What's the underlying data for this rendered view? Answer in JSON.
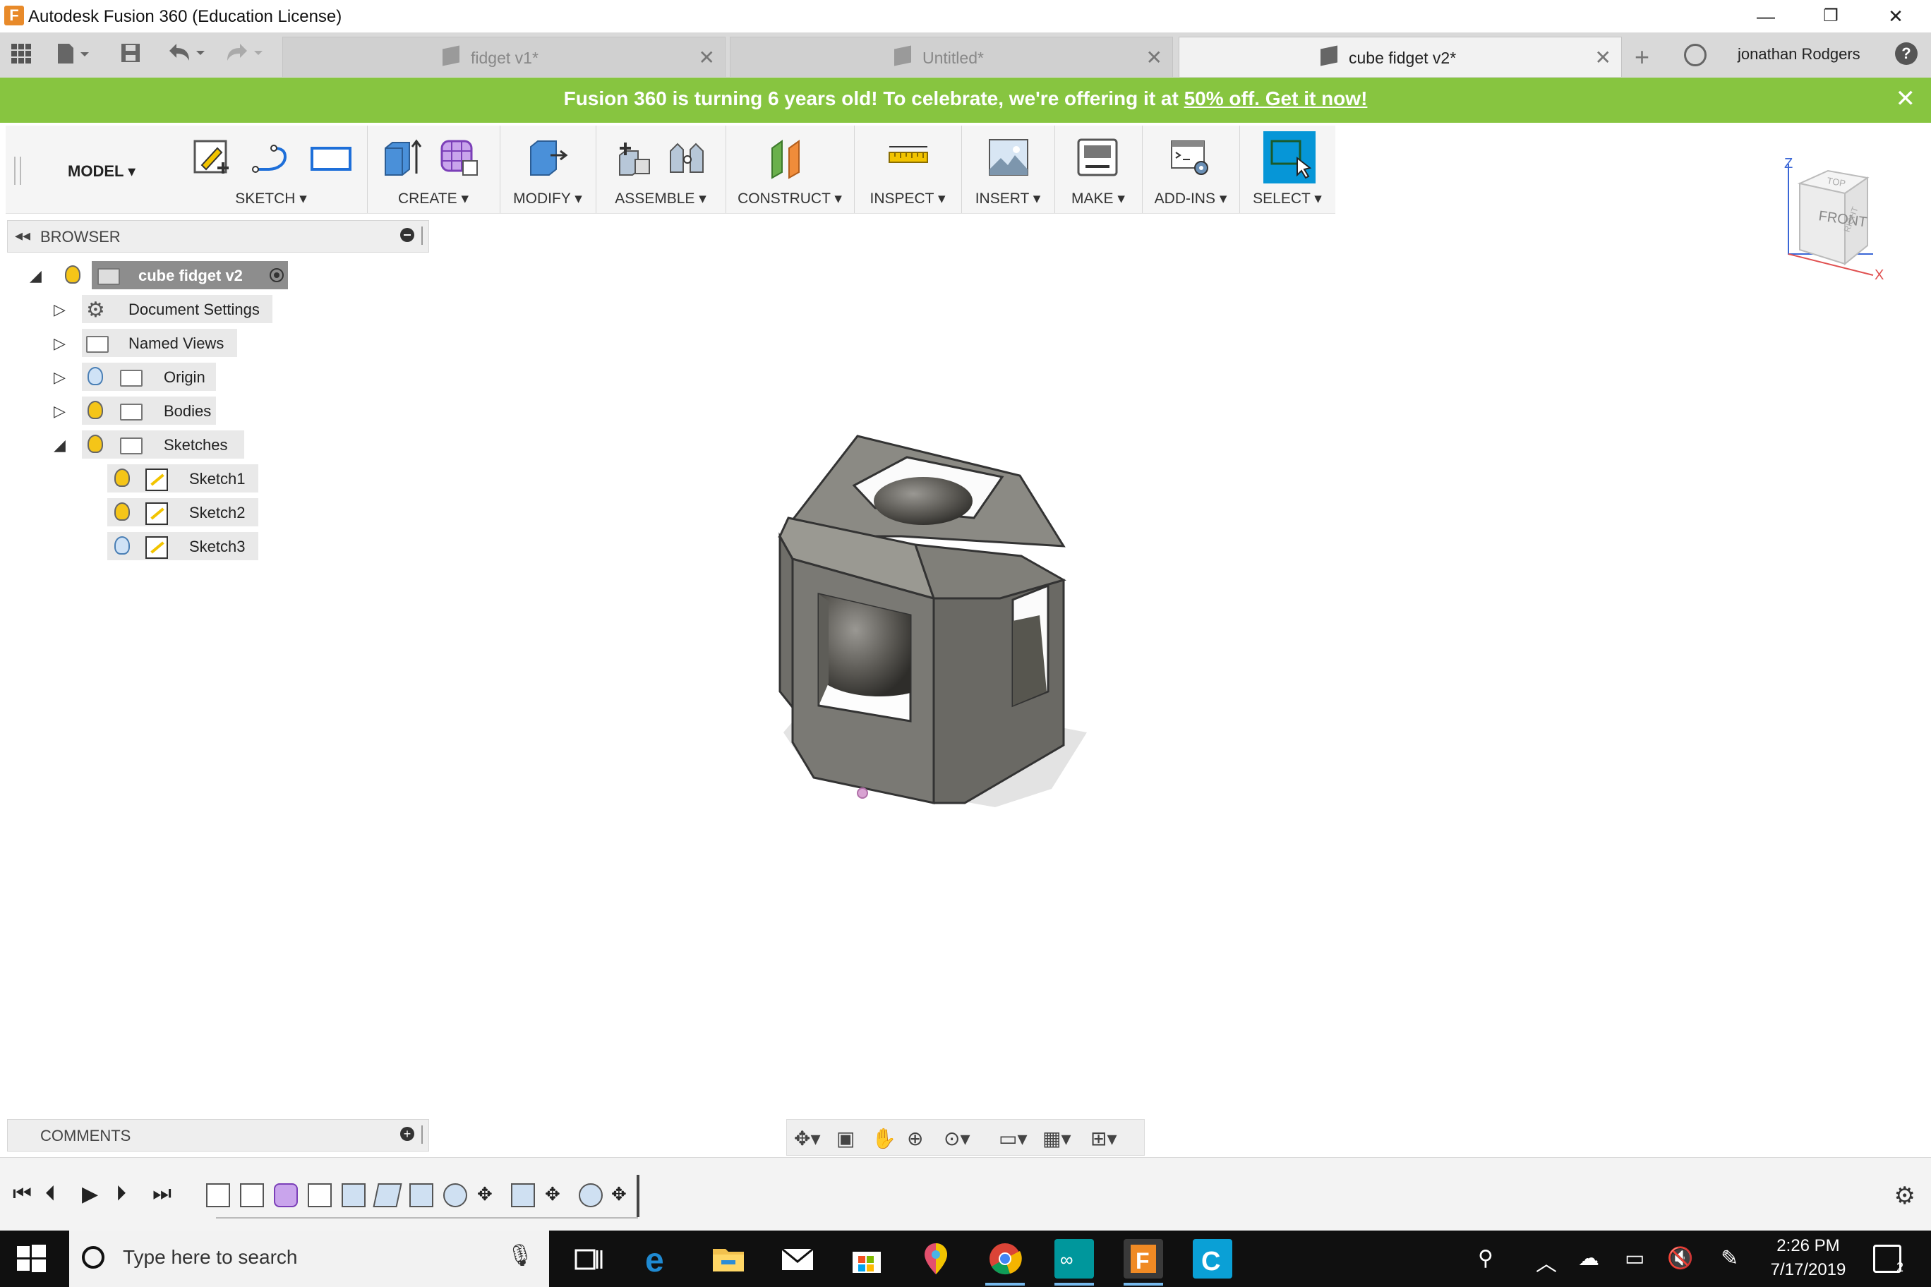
{
  "window": {
    "title": "Autodesk Fusion 360 (Education License)",
    "logo_letter": "F",
    "minimize": "—",
    "restore": "❐",
    "close": "✕"
  },
  "tabs": [
    {
      "label": "fidget v1*"
    },
    {
      "label": "Untitled*"
    },
    {
      "label": "cube fidget v2*"
    }
  ],
  "user": {
    "name": "jonathan Rodgers"
  },
  "banner": {
    "text": "Fusion 360 is turning 6 years old! To celebrate, we're offering it at ",
    "link": "50% off. Get it now!",
    "close": "✕"
  },
  "toolbar": {
    "workspace": "MODEL ▾",
    "groups": [
      "SKETCH ▾",
      "CREATE ▾",
      "MODIFY ▾",
      "ASSEMBLE ▾",
      "CONSTRUCT ▾",
      "INSPECT ▾",
      "INSERT ▾",
      "MAKE ▾",
      "ADD-INS ▾",
      "SELECT ▾"
    ]
  },
  "browser": {
    "title": "BROWSER",
    "root": "cube fidget v2",
    "items": [
      "Document Settings",
      "Named Views",
      "Origin",
      "Bodies",
      "Sketches"
    ],
    "sketches": [
      "Sketch1",
      "Sketch2",
      "Sketch3"
    ]
  },
  "comments": {
    "title": "COMMENTS"
  },
  "viewcube": {
    "top": "TOP",
    "front": "FRONT",
    "right": "RIGHT",
    "axis_z": "Z",
    "axis_x": "X"
  },
  "taskbar": {
    "search_placeholder": "Type here to search",
    "time": "2:26 PM",
    "date": "7/17/2019",
    "notifications": "2"
  },
  "colors": {
    "banner": "#87c540",
    "select_active": "#0696d7",
    "taskbar": "#101010"
  }
}
